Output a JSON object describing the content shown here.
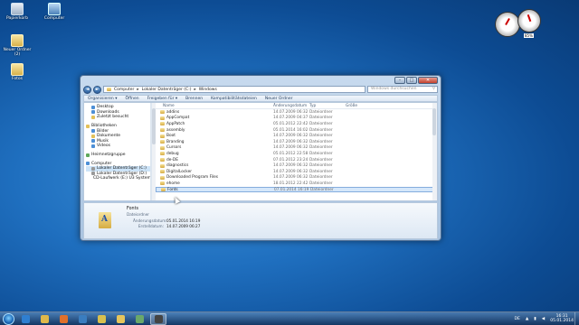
{
  "desktop": {
    "icons": [
      {
        "label": "Papierkorb",
        "icon": "recycle-bin-icon"
      },
      {
        "label": "Computer",
        "icon": "computer-icon"
      },
      {
        "label": "Neuer Ordner (2)",
        "icon": "folder-icon"
      },
      {
        "label": "Fotos",
        "icon": "folder-icon"
      }
    ]
  },
  "gadget": {
    "left_readout": "",
    "right_readout": "85%"
  },
  "window": {
    "nav": {
      "back": "◄",
      "forward": "►"
    },
    "breadcrumb": [
      "Computer",
      "Lokaler Datenträger (C:)",
      "Windows"
    ],
    "search_placeholder": "Windows durchsuchen",
    "toolbar": [
      "Organisieren ▾",
      "Öffnen",
      "Freigeben für ▾",
      "Brennen",
      "Kompatibilitätsdateien",
      "Neuer Ordner"
    ],
    "navpane": [
      {
        "label": "Desktop",
        "level": 2,
        "icon": "desktop-icon"
      },
      {
        "label": "Downloads",
        "level": 2,
        "icon": "downloads-icon"
      },
      {
        "label": "Zuletzt besucht",
        "level": 2,
        "icon": "recent-icon"
      },
      {
        "label": "",
        "gap": true
      },
      {
        "label": "Bibliotheken",
        "level": 1,
        "icon": "libraries-icon"
      },
      {
        "label": "Bilder",
        "level": 2,
        "icon": "pictures-icon"
      },
      {
        "label": "Dokumente",
        "level": 2,
        "icon": "documents-icon"
      },
      {
        "label": "Musik",
        "level": 2,
        "icon": "music-icon"
      },
      {
        "label": "Videos",
        "level": 2,
        "icon": "videos-icon"
      },
      {
        "label": "",
        "gap": true
      },
      {
        "label": "Heimnetzgruppe",
        "level": 1,
        "icon": "homegroup-icon"
      },
      {
        "label": "",
        "gap": true
      },
      {
        "label": "Computer",
        "level": 1,
        "icon": "computer-icon"
      },
      {
        "label": "Lokaler Datenträger (C:)",
        "level": 2,
        "icon": "drive-icon",
        "selected": true
      },
      {
        "label": "Lokaler Datenträger (D:)",
        "level": 2,
        "icon": "drive-icon"
      },
      {
        "label": "CD-Laufwerk (E:) U3 System",
        "level": 2,
        "icon": "cd-drive-icon"
      }
    ],
    "columns": {
      "name": "Name",
      "date": "Änderungsdatum",
      "type": "Typ",
      "size": "Größe"
    },
    "files": [
      {
        "name": "addins",
        "date": "14.07.2009 06:32",
        "type": "Dateiordner"
      },
      {
        "name": "AppCompat",
        "date": "14.07.2009 04:37",
        "type": "Dateiordner"
      },
      {
        "name": "AppPatch",
        "date": "05.01.2012 22:42",
        "type": "Dateiordner"
      },
      {
        "name": "assembly",
        "date": "05.01.2014 16:02",
        "type": "Dateiordner"
      },
      {
        "name": "Boot",
        "date": "14.07.2009 06:32",
        "type": "Dateiordner"
      },
      {
        "name": "Branding",
        "date": "14.07.2009 06:32",
        "type": "Dateiordner"
      },
      {
        "name": "Cursors",
        "date": "14.07.2009 06:32",
        "type": "Dateiordner"
      },
      {
        "name": "debug",
        "date": "05.01.2012 22:58",
        "type": "Dateiordner"
      },
      {
        "name": "de-DE",
        "date": "07.01.2012 23:24",
        "type": "Dateiordner"
      },
      {
        "name": "diagnostics",
        "date": "14.07.2009 06:32",
        "type": "Dateiordner"
      },
      {
        "name": "DigitalLocker",
        "date": "14.07.2009 06:32",
        "type": "Dateiordner"
      },
      {
        "name": "Downloaded Program Files",
        "date": "14.07.2009 06:32",
        "type": "Dateiordner"
      },
      {
        "name": "ehome",
        "date": "18.01.2012 22:42",
        "type": "Dateiordner"
      },
      {
        "name": "Fonts",
        "date": "07.01.2014 16:19",
        "type": "Dateiordner",
        "selected": true
      }
    ],
    "details": {
      "name": "Fonts",
      "type": "Dateiordner",
      "modified_label": "Änderungsdatum:",
      "modified_value": "05.01.2014 16:19",
      "created_label": "Erstelldatum:",
      "created_value": "14.07.2009 06:27",
      "icon_letter": "A"
    }
  },
  "taskbar": {
    "apps": [
      "ie-icon",
      "explorer-icon",
      "firefox-icon",
      "media-player-icon",
      "media-icon",
      "folder-icon",
      "app-icon",
      "app-icon"
    ],
    "active_index": 7,
    "lang": "DE",
    "time": "16:31",
    "date": "05.01.2014"
  }
}
